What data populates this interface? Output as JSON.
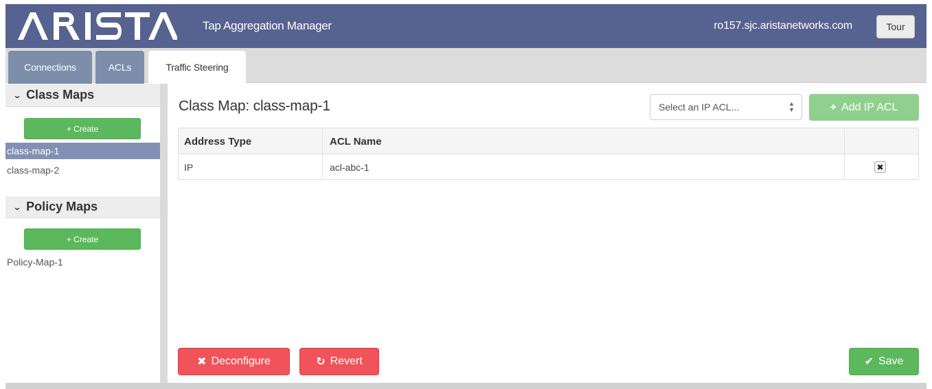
{
  "header": {
    "logo_text": "ARISTA",
    "app_title": "Tap Aggregation Manager",
    "hostname": "ro157.sjc.aristanetworks.com",
    "tour_label": "Tour"
  },
  "tabs": [
    {
      "label": "Connections"
    },
    {
      "label": "ACLs"
    },
    {
      "label": "Traffic Steering"
    }
  ],
  "sidebar": {
    "class_maps": {
      "heading": "Class Maps",
      "create_label": "+ Create",
      "items": [
        "class-map-1",
        "class-map-2"
      ],
      "selected": "class-map-1"
    },
    "policy_maps": {
      "heading": "Policy Maps",
      "create_label": "+ Create",
      "items": [
        "Policy-Map-1"
      ]
    }
  },
  "main": {
    "title": "Class Map: class-map-1",
    "acl_select_placeholder": "Select an IP ACL...",
    "add_acl_label": "Add IP ACL",
    "table": {
      "columns": [
        "Address Type",
        "ACL Name"
      ],
      "rows": [
        {
          "address_type": "IP",
          "acl_name": "acl-abc-1"
        }
      ]
    },
    "deconfigure_label": "Deconfigure",
    "revert_label": "Revert",
    "save_label": "Save"
  },
  "colors": {
    "header_bg": "#56628f",
    "tab_active_bg": "#7c8eaa",
    "success": "#5cb85c",
    "danger": "#f0535a",
    "selected_item": "#8390b3"
  }
}
